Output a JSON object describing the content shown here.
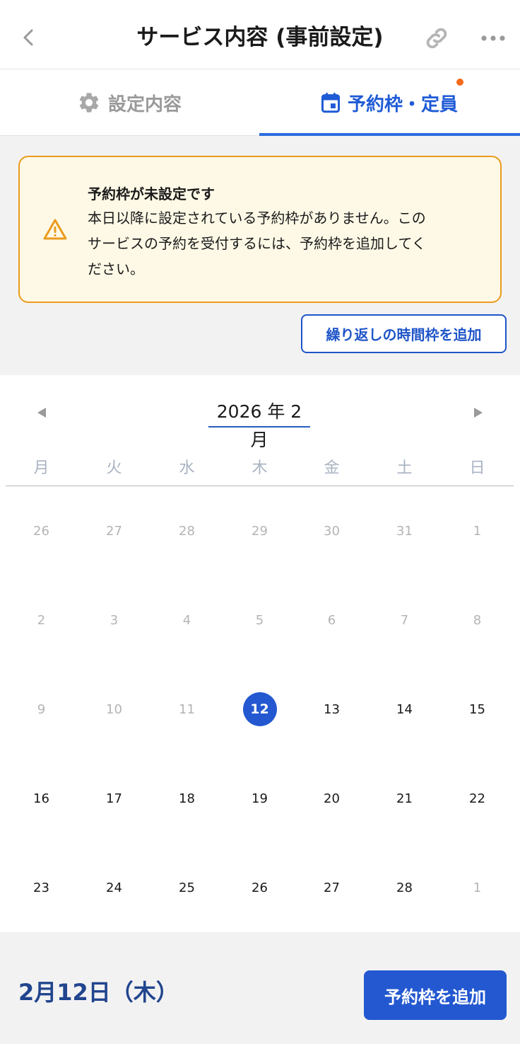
{
  "header": {
    "title": "サービス内容 (事前設定)",
    "back_icon": "chevron-left-icon",
    "link_icon": "link-icon",
    "more_icon": "more-horizontal-icon"
  },
  "tabs": [
    {
      "label": "設定内容",
      "icon": "gear-icon",
      "active": false
    },
    {
      "label": "予約枠・定員",
      "icon": "calendar-icon",
      "active": true,
      "has_notification_dot": true
    }
  ],
  "alert": {
    "title": "予約枠が未設定です",
    "lines": [
      "本日以降に設定されている予約枠がありません。この",
      "サービスの予約を受付するには、予約枠を追加してく",
      "ださい。"
    ],
    "icon": "warning-icon"
  },
  "repeat_button": "繰り返しの時間枠を追加",
  "calendar": {
    "month_label": "2026 年 2月",
    "weekdays": [
      "月",
      "火",
      "水",
      "木",
      "金",
      "土",
      "日"
    ],
    "weeks": [
      [
        "26",
        "27",
        "28",
        "29",
        "30",
        "31",
        "1"
      ],
      [
        "2",
        "3",
        "4",
        "5",
        "6",
        "7",
        "8"
      ],
      [
        "9",
        "10",
        "11",
        "12",
        "13",
        "14",
        "15"
      ],
      [
        "16",
        "17",
        "18",
        "19",
        "20",
        "21",
        "22"
      ],
      [
        "23",
        "24",
        "25",
        "26",
        "27",
        "28",
        "1"
      ]
    ],
    "selected_day": "12"
  },
  "footer": {
    "selected_date": "2月12日（木）",
    "add_button": "予約枠を追加"
  },
  "colors": {
    "accent": "#2358d0",
    "tab_active": "#1f5bd6",
    "warning_border": "#eb9b1d",
    "warning_bg": "#fef9e6",
    "notification_dot": "#f36a1c"
  }
}
